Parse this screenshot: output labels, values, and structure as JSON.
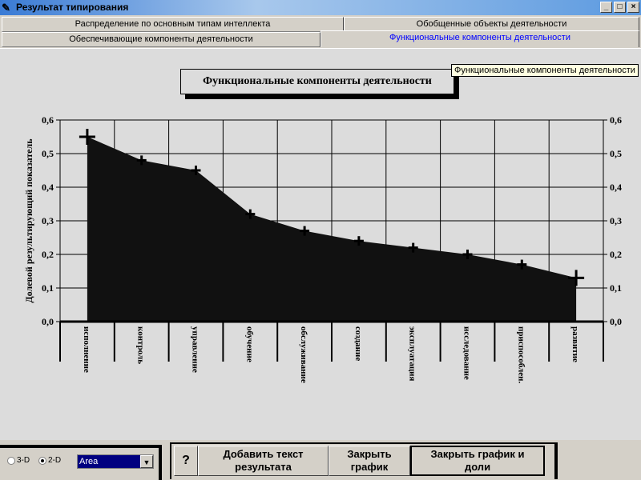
{
  "window": {
    "title": "Результат типирования",
    "minimize": "_",
    "maximize": "□",
    "close": "×"
  },
  "tabs": [
    {
      "label": "Распределение по основным типам интеллекта",
      "active": false
    },
    {
      "label": "Обобщенные объекты деятельности",
      "active": false
    },
    {
      "label": "Обеспечивающие компоненты деятельности",
      "active": false
    },
    {
      "label": "Функциональные компоненты деятельности",
      "active": true
    }
  ],
  "tooltip": "Функциональные компоненты деятельности",
  "chart_data": {
    "type": "area",
    "title": "Функциональные компоненты деятельности",
    "ylabel": "Долевой результирующий показатель",
    "ylim": [
      0,
      0.6
    ],
    "yticks": [
      "0,0",
      "0,1",
      "0,2",
      "0,3",
      "0,4",
      "0,5",
      "0,6"
    ],
    "categories": [
      "исполнение",
      "контроль",
      "управление",
      "обучение",
      "обслуживание",
      "создание",
      "эксплуатация",
      "исследование",
      "приспособлен.",
      "развитие"
    ],
    "values": [
      0.55,
      0.48,
      0.45,
      0.32,
      0.27,
      0.24,
      0.22,
      0.2,
      0.17,
      0.13
    ],
    "grid": true,
    "fill_color": "#111111"
  },
  "controls": {
    "radio_3d": "3-D",
    "radio_2d": "2-D",
    "selected_mode": "2-D",
    "chart_type": "Area",
    "help_button": "?",
    "add_text_button": "Добавить текст\nрезультата",
    "close_chart_button": "Закрыть\nграфик",
    "close_chart_shares_button": "Закрыть график и\nдоли"
  }
}
